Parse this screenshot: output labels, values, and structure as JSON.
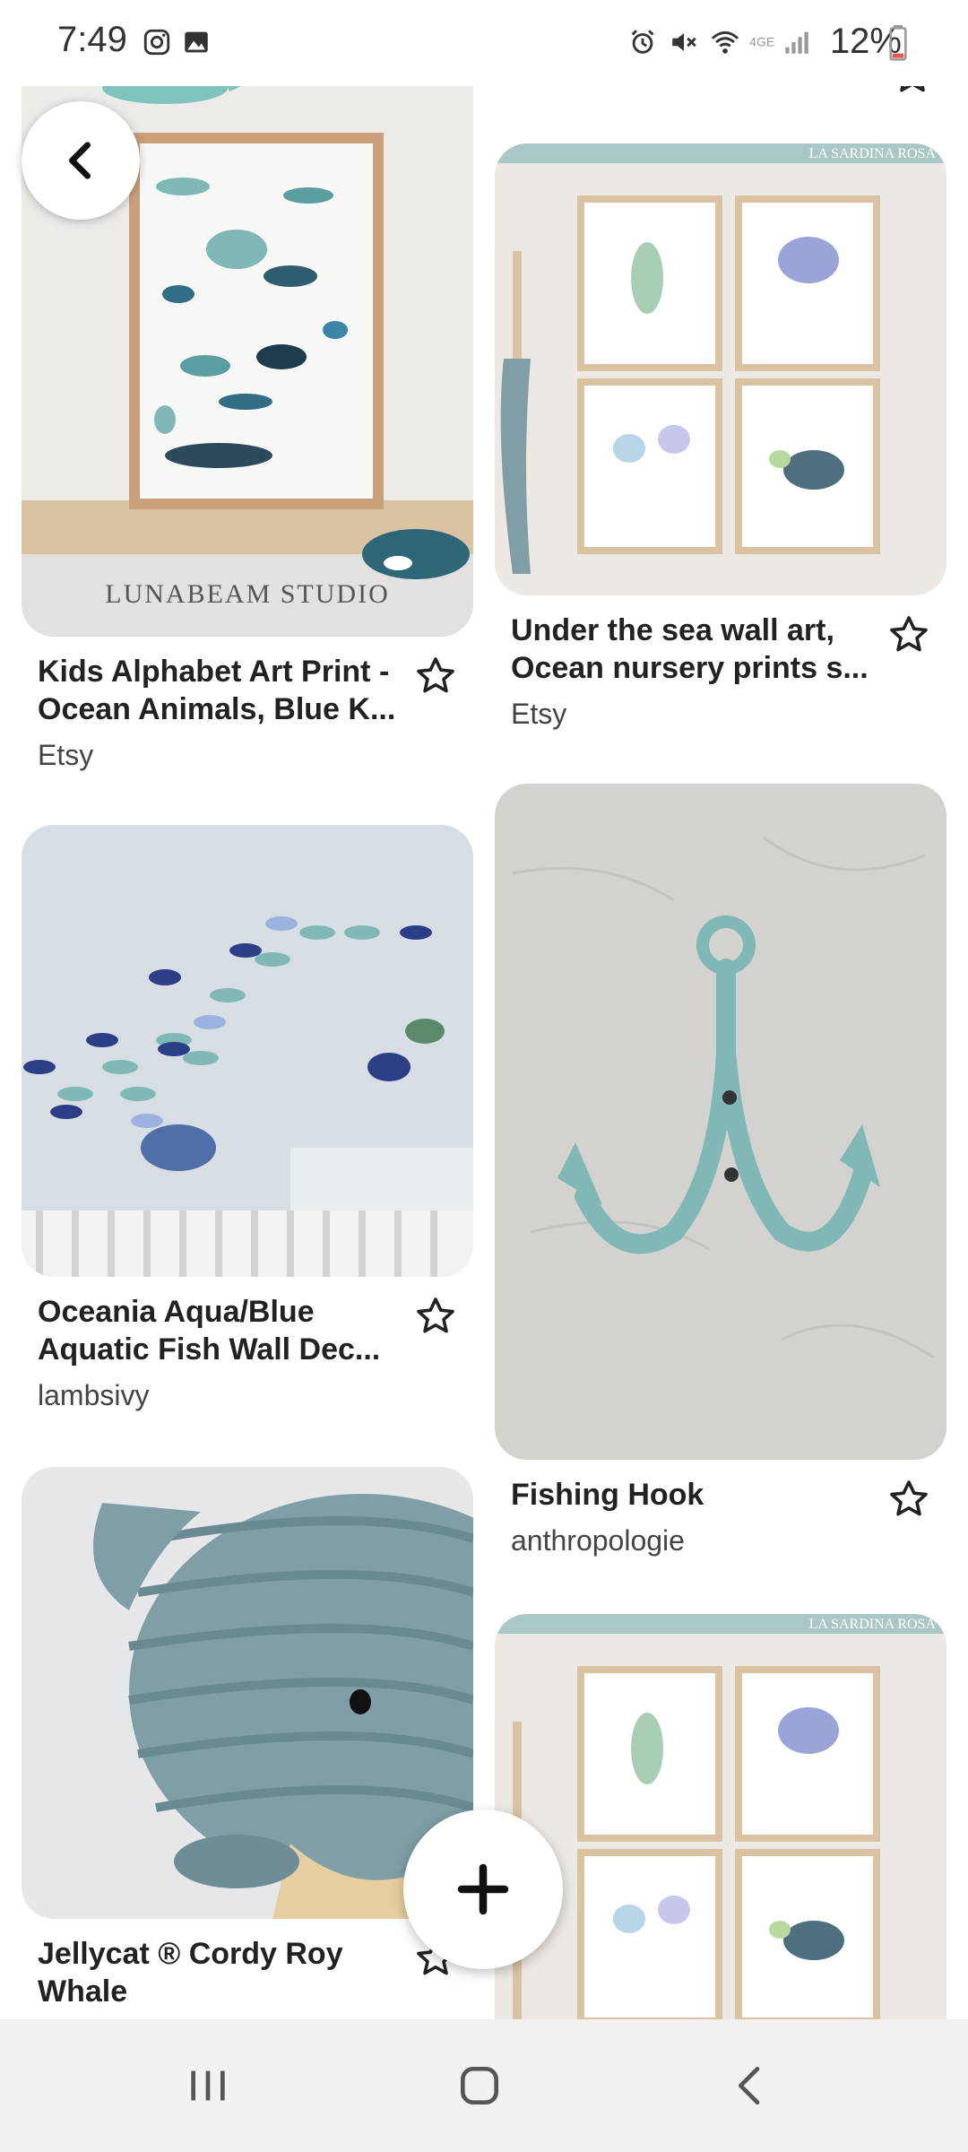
{
  "status_bar": {
    "time": "7:49",
    "battery": "12%",
    "icons": [
      "instagram-icon",
      "gallery-icon",
      "alarm-icon",
      "mute-icon",
      "wifi-icon",
      "lte-icon",
      "signal-icon",
      "battery-icon"
    ]
  },
  "pins": [
    {
      "title": "Kids Alphabet Art Print - Ocean Animals, Blue K...",
      "source": "Etsy",
      "image_label": "LUNABEAM STUDIO"
    },
    {
      "title": "Under the sea wall art, Ocean nursery prints s...",
      "source": "Etsy",
      "image_label": "LA SARDINA ROSA"
    },
    {
      "title": "Oceania Aqua/Blue Aquatic Fish Wall Dec...",
      "source": "lambsivy"
    },
    {
      "title": "Fishing Hook",
      "source": "anthropologie"
    },
    {
      "title": "Jellycat ® Cordy Roy Whale",
      "source": ""
    },
    {
      "title": "",
      "source": "",
      "image_label": "LA SARDINA ROSA"
    }
  ],
  "colors": {
    "accent_teal": "#7fb8b5",
    "star_stroke": "#222222",
    "nav_bg": "#f1f1f1"
  }
}
